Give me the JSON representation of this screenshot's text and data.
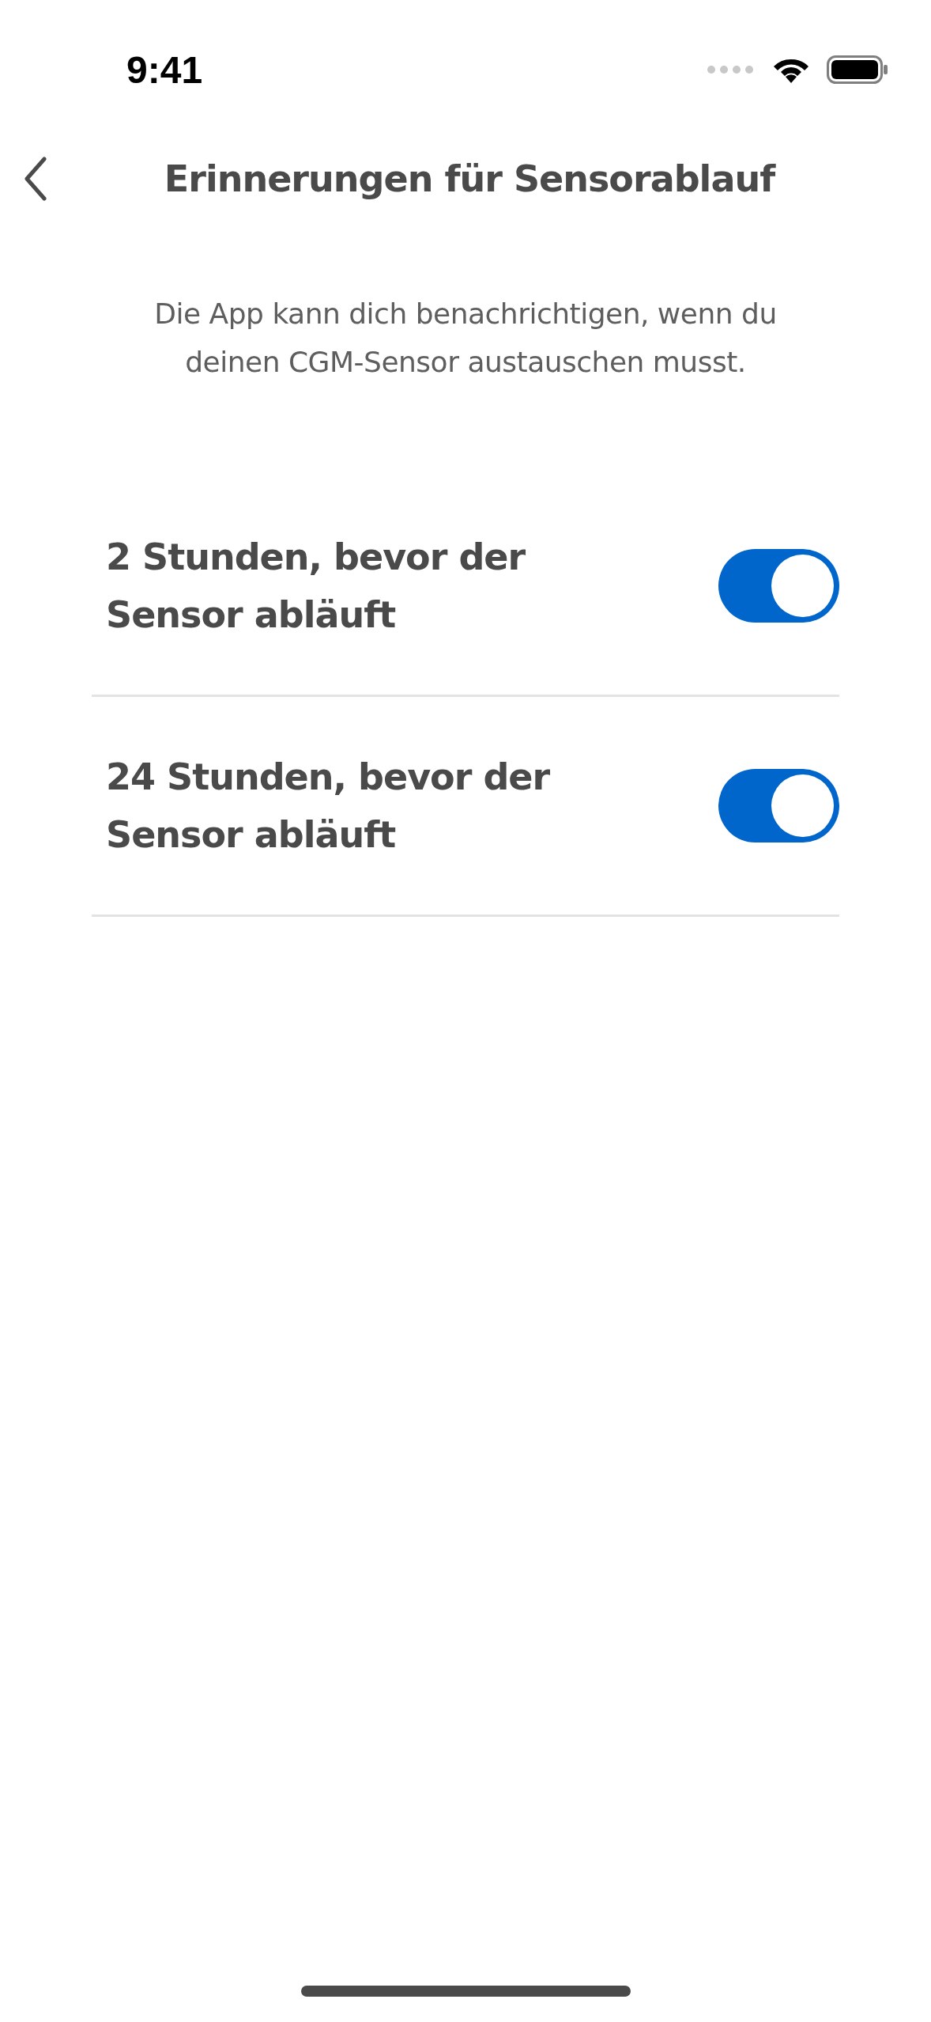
{
  "status_bar": {
    "time": "9:41"
  },
  "header": {
    "title": "Erinnerungen für Sensorablauf"
  },
  "description": "Die App kann dich benachrichtigen, wenn du deinen CGM-Sensor austauschen musst.",
  "reminders": [
    {
      "label": "2 Stunden, bevor der Sensor abläuft",
      "on": true
    },
    {
      "label": "24 Stunden, bevor der Sensor abläuft",
      "on": true
    }
  ]
}
